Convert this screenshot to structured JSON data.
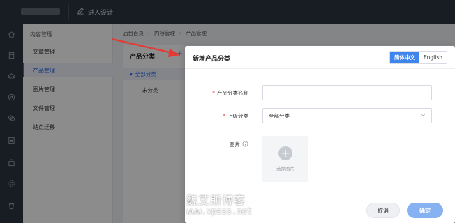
{
  "topbar": {
    "design_label": "进入设计"
  },
  "rail": {
    "icons": [
      "home-icon",
      "file-icon",
      "layers-icon",
      "compass-icon",
      "chat-icon",
      "list-icon",
      "bag-icon",
      "gear-icon",
      "trash-icon"
    ]
  },
  "menu": {
    "title": "内容管理",
    "items": [
      {
        "label": "文章管理",
        "active": false
      },
      {
        "label": "产品管理",
        "active": true
      },
      {
        "label": "图片管理",
        "active": false
      },
      {
        "label": "文件管理",
        "active": false
      },
      {
        "label": "站点迁移",
        "active": false
      }
    ]
  },
  "breadcrumb": [
    "后台首页",
    "内容管理",
    "产品管理"
  ],
  "panel": {
    "title": "产品分类",
    "add_symbol": "+",
    "tree_root": "全部分类",
    "tree_child": "未分类"
  },
  "modal": {
    "title": "新增产品分类",
    "lang_options": [
      {
        "label": "简体中文",
        "active": true
      },
      {
        "label": "English",
        "active": false
      }
    ],
    "fields": {
      "name_label": "产品分类名称",
      "name_value": "",
      "parent_label": "上级分类",
      "parent_value": "全部分类",
      "image_label": "图片",
      "upload_text": "选择图片"
    },
    "cancel_label": "取消",
    "ok_label": "确定"
  },
  "watermark": {
    "line1": "魏艾斯博客",
    "line2": "www.vpsss.net"
  },
  "colors": {
    "primary": "#3d84ec",
    "dark": "#2d3643",
    "required": "#e53935",
    "annotation": "#e53935"
  }
}
